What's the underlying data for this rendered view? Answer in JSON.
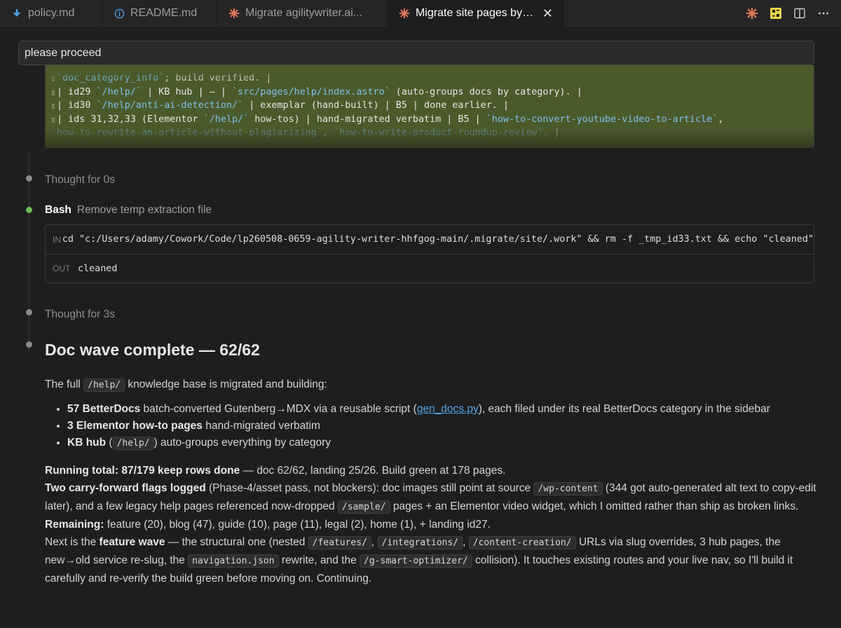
{
  "tabs": [
    {
      "label": "policy.md",
      "icon": "download-arrow-icon",
      "color": "#4fa6ea"
    },
    {
      "label": "README.md",
      "icon": "info-icon",
      "color": "#4fa6ea"
    },
    {
      "label": "Migrate agilitywriter.ai...",
      "icon": "claude-spark-icon",
      "color": "#e2775a"
    },
    {
      "label": "Migrate site pages by ki...",
      "icon": "claude-spark-icon",
      "color": "#e2775a",
      "active": true
    }
  ],
  "prompt": {
    "text": "please proceed"
  },
  "diff": {
    "line0": "`doc_category_info`; build verified. |",
    "line0_code": "`doc_category_info`",
    "line0_rest": "; build verified. |",
    "line1_a": "| id29 ",
    "line1_path": "`/help/`",
    "line1_b": " | KB hub | — | ",
    "line1_file": "`src/pages/help/index.astro`",
    "line1_c": " (auto-groups docs by category). |",
    "line2_a": "| id30 ",
    "line2_path": "`/help/anti-ai-detection/`",
    "line2_b": " | exemplar (hand-built) | B5 | done earlier. |",
    "line3_a": "| ids 31,32,33 (Elementor ",
    "line3_path": "`/help/`",
    "line3_b": " how-tos) | hand-migrated verbatim | B5 | ",
    "line3_file": "`how-to-convert-youtube-video-to-article`",
    "line3_c": ",",
    "line4_file1": "`how-to-rewrite-an-article-without-plagiarizing`",
    "line4_sep": ", ",
    "line4_file2": "`how-to-write-product-roundup-review`",
    "line4_c": ". |"
  },
  "timeline": {
    "thought1": "Thought for 0s",
    "bash": {
      "label": "Bash",
      "description": "Remove temp extraction file"
    },
    "terminal": {
      "in_tag": "IN",
      "command": "cd \"c:/Users/adamy/Cowork/Code/lp260508-0659-agility-writer-hhfgog-main/.migrate/site/.work\" && rm -f _tmp_id33.txt && echo \"cleaned\"",
      "out_tag": "OUT",
      "output": "cleaned"
    },
    "thought2": "Thought for 3s"
  },
  "message": {
    "heading": "Doc wave complete — 62/62",
    "intro_a": "The full ",
    "intro_code": "/help/",
    "intro_b": " knowledge base is migrated and building:",
    "bullet1_b": "57 BetterDocs",
    "bullet1_a": " batch-converted Gutenberg→MDX via a reusable script (",
    "bullet1_link": "gen_docs.py",
    "bullet1_c": "), each filed under its real BetterDocs category in the sidebar",
    "bullet2_b": "3 Elementor how-to pages",
    "bullet2_a": " hand-migrated verbatim",
    "bullet3_b": "KB hub",
    "bullet3_a": " (",
    "bullet3_code": "/help/",
    "bullet3_c": ") auto-groups everything by category",
    "running_b": "Running total: 87/179 keep rows done",
    "running_a": " — doc 62/62, landing 25/26. Build green at 178 pages.",
    "flags_b": "Two carry-forward flags logged",
    "flags_a": " (Phase-4/asset pass, not blockers): doc images still point at source ",
    "flags_code1": "/wp-content",
    "flags_c": " (344 got auto-generated alt text to copy-edit later), and a few legacy help pages referenced now-dropped ",
    "flags_code2": "/sample/",
    "flags_d": " pages + an Elementor video widget, which I omitted rather than ship as broken links.",
    "remaining_b": "Remaining:",
    "remaining_a": " feature (20), blog (47), guide (10), page (11), legal (2), home (1), + landing id27.",
    "next_a": "Next is the ",
    "next_b": "feature wave",
    "next_c": " — the structural one (nested ",
    "next_code1": "/features/",
    "next_sep1": ", ",
    "next_code2": "/integrations/",
    "next_sep2": ", ",
    "next_code3": "/content-creation/",
    "next_d": " URLs via slug overrides, 3 hub pages, the new→old service re-slug, the ",
    "next_code4": "navigation.json",
    "next_e": " rewrite, and the ",
    "next_code5": "/g-smart-optimizer/",
    "next_f": " collision). It touches existing routes and your live nav, so I'll build it carefully and re-verify the build green before moving on. Continuing."
  },
  "colors": {
    "accent_green": "#6bbf59",
    "link": "#4fa6ea",
    "diff_bg": "#4b5a2a",
    "claude": "#e2775a",
    "badge_yellow": "#e8d44d"
  }
}
